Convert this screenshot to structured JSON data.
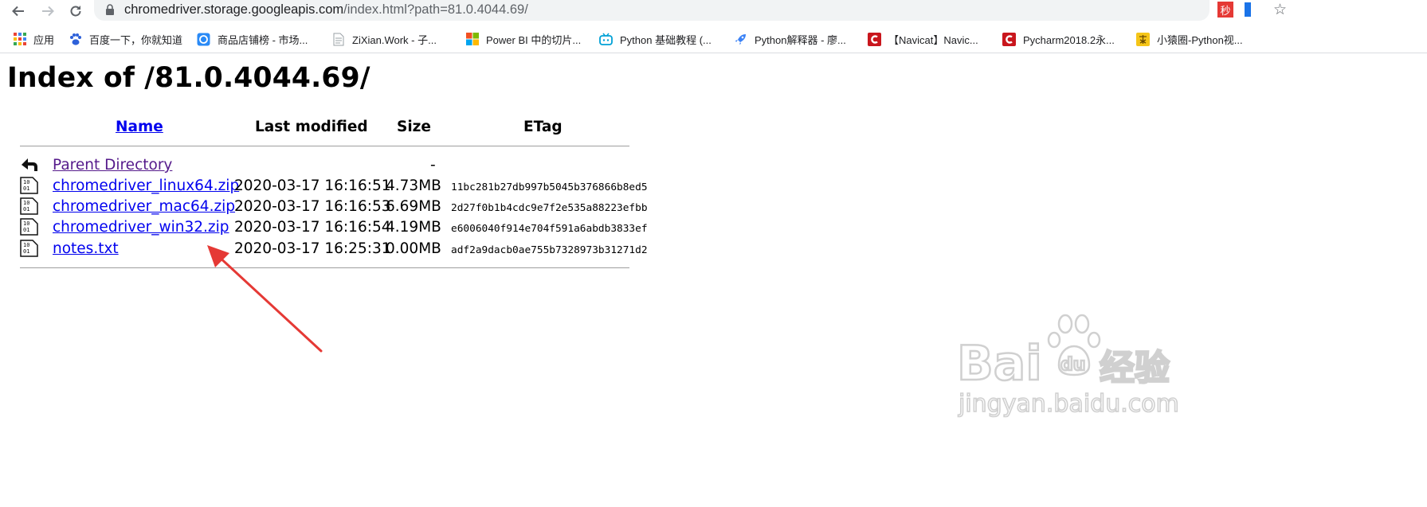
{
  "browser": {
    "url_host": "chromedriver.storage.googleapis.com",
    "url_path": "/index.html?path=81.0.4044.69/",
    "icons": [
      "back-arrow-icon",
      "forward-arrow-icon",
      "reload-icon",
      "lock-icon",
      "bookmark-star-icon"
    ],
    "extensions": [
      {
        "name": "miaosha-ext-icon",
        "label": "秒",
        "color": "#e53935"
      }
    ]
  },
  "bookmarks": [
    {
      "label": "应用",
      "icon": "apps-grid-icon"
    },
    {
      "label": "百度一下，你就知道",
      "icon": "baidu-paw-icon"
    },
    {
      "label": "商品店铺榜 - 市场...",
      "icon": "store-icon"
    },
    {
      "label": "ZiXian.Work - 子...",
      "icon": "document-icon"
    },
    {
      "label": "Power BI 中的切片...",
      "icon": "microsoft-logo-icon"
    },
    {
      "label": "Python 基础教程 (...",
      "icon": "bilibili-tv-icon"
    },
    {
      "label": "Python解释器 - 廖...",
      "icon": "rocket-icon"
    },
    {
      "label": "【Navicat】Navic...",
      "icon": "csdn-c-icon"
    },
    {
      "label": "Pycharm2018.2永...",
      "icon": "csdn-c-icon"
    },
    {
      "label": "小猿圈-Python视...",
      "icon": "xiaoyuan-icon"
    }
  ],
  "page": {
    "title": "Index of /81.0.4044.69/",
    "columns": {
      "name": "Name",
      "modified": "Last modified",
      "size": "Size",
      "etag": "ETag"
    },
    "rows": [
      {
        "name": "Parent Directory",
        "modified": "",
        "size": "-",
        "etag": "",
        "icon": "back-folder-icon"
      },
      {
        "name": "chromedriver_linux64.zip",
        "modified": "2020-03-17 16:16:51",
        "size": "4.73MB",
        "etag": "11bc281b27db997b5045b376866b8ed5",
        "icon": "binary-file-icon"
      },
      {
        "name": "chromedriver_mac64.zip",
        "modified": "2020-03-17 16:16:53",
        "size": "6.69MB",
        "etag": "2d27f0b1b4cdc9e7f2e535a88223efbb",
        "icon": "binary-file-icon"
      },
      {
        "name": "chromedriver_win32.zip",
        "modified": "2020-03-17 16:16:54",
        "size": "4.19MB",
        "etag": "e6006040f914e704f591a6abdb3833ef",
        "icon": "binary-file-icon"
      },
      {
        "name": "notes.txt",
        "modified": "2020-03-17 16:25:31",
        "size": "0.00MB",
        "etag": "adf2a9dacb0ae755b7328973b31271d2",
        "icon": "binary-file-icon"
      }
    ]
  },
  "annotation": {
    "arrow_color": "#e53935",
    "points_to": "chromedriver_win32.zip"
  },
  "watermark": {
    "brand": "Bai du 经验",
    "url": "jingyan.baidu.com"
  }
}
